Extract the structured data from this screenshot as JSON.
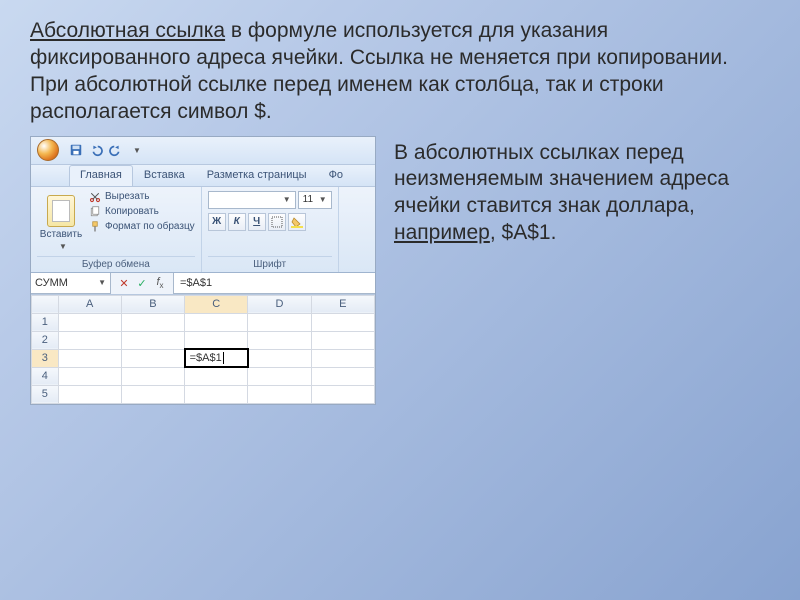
{
  "paragraph1_fragments": {
    "u1": "Абсолютная ссылка",
    "rest": " в формуле используется для указания фиксированного адреса ячейки. Ссылка не меняется при копировании. При абсолютной ссылке перед именем как столбца, так и строки располагается символ $."
  },
  "paragraph2_fragments": {
    "p1": "В абсолютных ссылках перед неизменяемым значением адреса ячейки ставится знак доллара, ",
    "u2": "например",
    "p2": ", $А$1."
  },
  "excel": {
    "tabs": {
      "home": "Главная",
      "insert": "Вставка",
      "layout": "Разметка страницы",
      "formulas": "Фо"
    },
    "clipboard": {
      "paste": "Вставить",
      "cut": "Вырезать",
      "copy": "Копировать",
      "format": "Формат по образцу",
      "group": "Буфер обмена"
    },
    "font": {
      "size": "11",
      "group": "Шрифт",
      "bold": "Ж",
      "italic": "К",
      "underline": "Ч"
    },
    "namebox": "СУММ",
    "formula": "=$A$1",
    "columns": [
      "A",
      "B",
      "C",
      "D",
      "E"
    ],
    "rows": [
      "1",
      "2",
      "3",
      "4",
      "5"
    ],
    "active_cell_value": "=$A$1"
  }
}
